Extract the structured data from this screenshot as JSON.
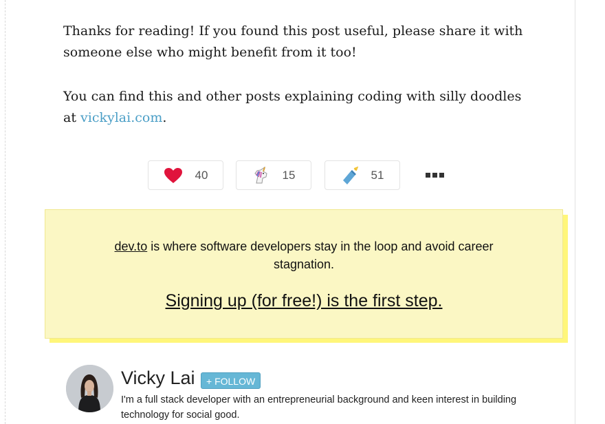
{
  "article": {
    "paragraph1": "Thanks for reading! If you found this post useful, please share it with someone else who might benefit from it too!",
    "paragraph2_text": "You can find this and other posts explaining coding with silly doodles at ",
    "paragraph2_link": "vickylai.com",
    "paragraph2_end": "."
  },
  "reactions": {
    "like_count": "40",
    "unicorn_count": "15",
    "save_count": "51"
  },
  "cta": {
    "site_link": "dev.to",
    "text": " is where software developers stay in the loop and avoid career stagnation.",
    "signup": "Signing up (for free!) is the first step."
  },
  "author": {
    "name": "Vicky Lai",
    "follow_label": "+ FOLLOW",
    "bio": "I'm a full stack developer with an entrepreneurial background and keen interest in building technology for social good."
  },
  "colors": {
    "link": "#4a9ec6",
    "heart": "#e0143c",
    "cta_background": "#fbf7c4",
    "cta_shadow": "#fff67a",
    "follow_button": "#66b7d6"
  }
}
